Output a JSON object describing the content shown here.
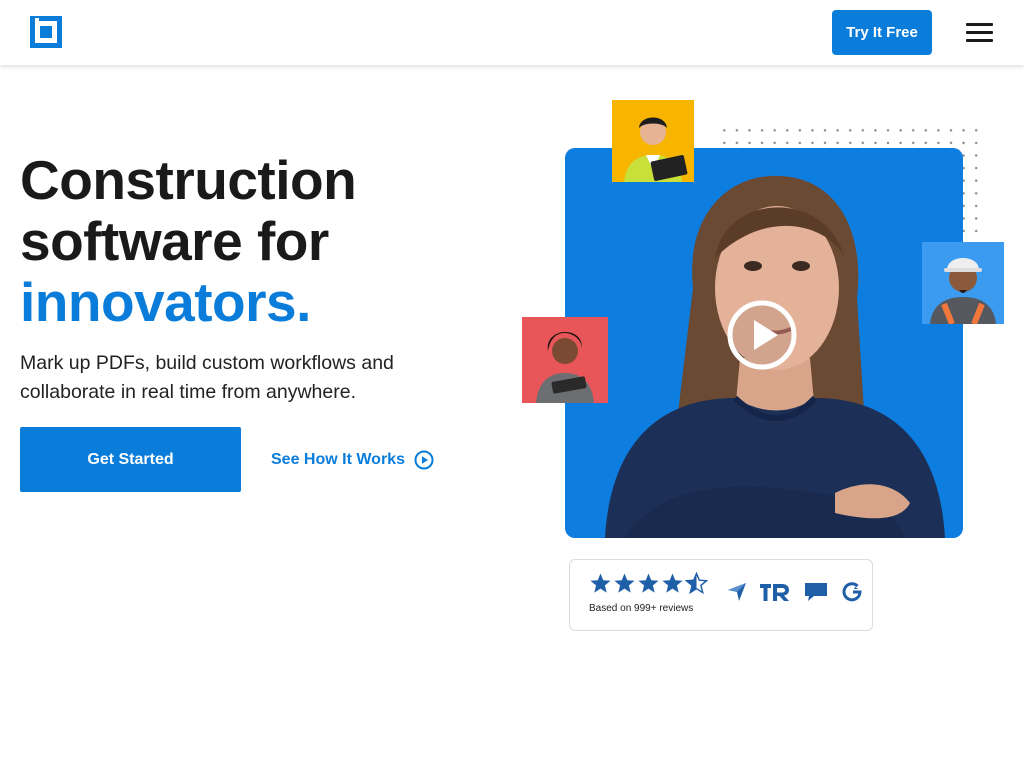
{
  "header": {
    "logo_icon": "bluebeam-logo-icon",
    "try_free_label": "Try It Free",
    "menu_icon": "hamburger-menu-icon"
  },
  "hero": {
    "headline_line1": "Construction",
    "headline_line2": "software for",
    "headline_accent": "innovators.",
    "subtext": "Mark up PDFs, build custom workflows and collaborate in real time from anywhere.",
    "primary_cta": "Get Started",
    "secondary_cta": "See How It Works",
    "secondary_cta_icon": "play-circle-icon",
    "video_icon": "play-icon"
  },
  "reviews": {
    "rating": 4.5,
    "rating_max": 5,
    "caption": "Based on 999+ reviews",
    "platform_icons": [
      "capterra-icon",
      "trustradius-icon",
      "software-advice-icon",
      "g2-icon"
    ]
  },
  "colors": {
    "brand_blue": "#0a7ddb",
    "text_dark": "#1a1a1a",
    "star_blue": "#1f5fa8",
    "thumb_yellow": "#f7b500",
    "thumb_blue": "#3b9bf0",
    "thumb_red": "#e8565a"
  }
}
